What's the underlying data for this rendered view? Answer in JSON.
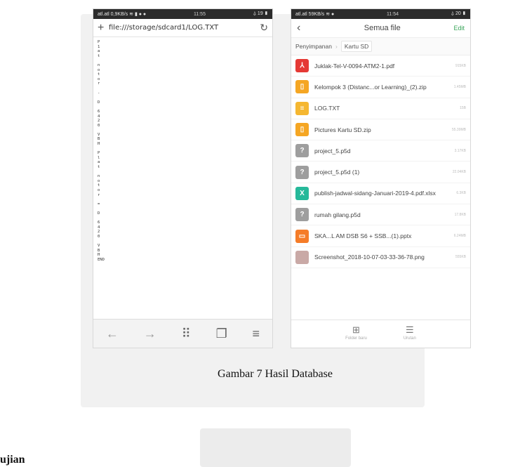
{
  "left_phone": {
    "status_left": "atl.atl 0,9KB/s ≋ ▮ ● ●",
    "status_time": "11:55",
    "status_right": "⍙ 19 ▮",
    "url": "file:///storage/sdcard1/LOG.TXT",
    "text_lines": [
      "P",
      "1",
      "a",
      "t",
      "",
      "n",
      "o",
      "t",
      "o",
      "r",
      "",
      "-",
      "",
      "D",
      "",
      "6",
      "4",
      "2",
      "0",
      "",
      "V",
      "B",
      "H",
      "",
      "P",
      "l",
      "a",
      "t",
      "",
      "n",
      "o",
      "t",
      "o",
      "r",
      "",
      "=",
      "",
      "D",
      "",
      "6",
      "4",
      "2",
      "0",
      "",
      "V",
      "B",
      "H",
      "END"
    ]
  },
  "right_phone": {
    "status_left": "atl.atl 59KB/s ≋ ●",
    "status_time": "11:54",
    "status_right": "⍙ 20 ▮",
    "title": "Semua file",
    "edit_label": "Edit",
    "breadcrumbs": [
      "Penyimpanan",
      "Kartu SD"
    ],
    "files": [
      {
        "name": "Juklak-Tel-V-0094-ATM2-1.pdf",
        "size": "915KB",
        "icon": "pdf-icon",
        "color": "#e53935"
      },
      {
        "name": "Kelompok 3 (Distanc...or Learning)_(2).zip",
        "size": "1.45MB",
        "icon": "zip-icon",
        "color": "#f5a623"
      },
      {
        "name": "LOG.TXT",
        "size": "15B",
        "icon": "text-file-icon",
        "color": "#f5b731"
      },
      {
        "name": "Pictures Kartu SD.zip",
        "size": "55.39MB",
        "icon": "zip-icon",
        "color": "#f5a623"
      },
      {
        "name": "project_5.p5d",
        "size": "3.17KB",
        "icon": "unknown-file-icon",
        "color": "#9e9e9e"
      },
      {
        "name": "project_5.p5d (1)",
        "size": "22.04KB",
        "icon": "unknown-file-icon",
        "color": "#9e9e9e"
      },
      {
        "name": "publish-jadwal-sidang-Januari-2019-4.pdf.xlsx",
        "size": "6.3KB",
        "icon": "excel-icon",
        "color": "#26b99a"
      },
      {
        "name": "rumah gilang.p5d",
        "size": "17.8KB",
        "icon": "unknown-file-icon",
        "color": "#9e9e9e"
      },
      {
        "name": "SKA...L AM DSB S6 + SSB...(1).pptx",
        "size": "6.24MB",
        "icon": "presentation-icon",
        "color": "#f57c28"
      },
      {
        "name": "Screenshot_2018-10-07-03-33-36-78.png",
        "size": "555KB",
        "icon": "image-thumbnail-icon",
        "color": "#c9a9a6"
      }
    ],
    "bottom_tools": [
      {
        "label": "Folder baru",
        "icon": "new-folder-icon"
      },
      {
        "label": "Urutan",
        "icon": "sort-icon"
      }
    ]
  },
  "caption": "Gambar 7 Hasil Database",
  "heading_fragment": "ujian"
}
